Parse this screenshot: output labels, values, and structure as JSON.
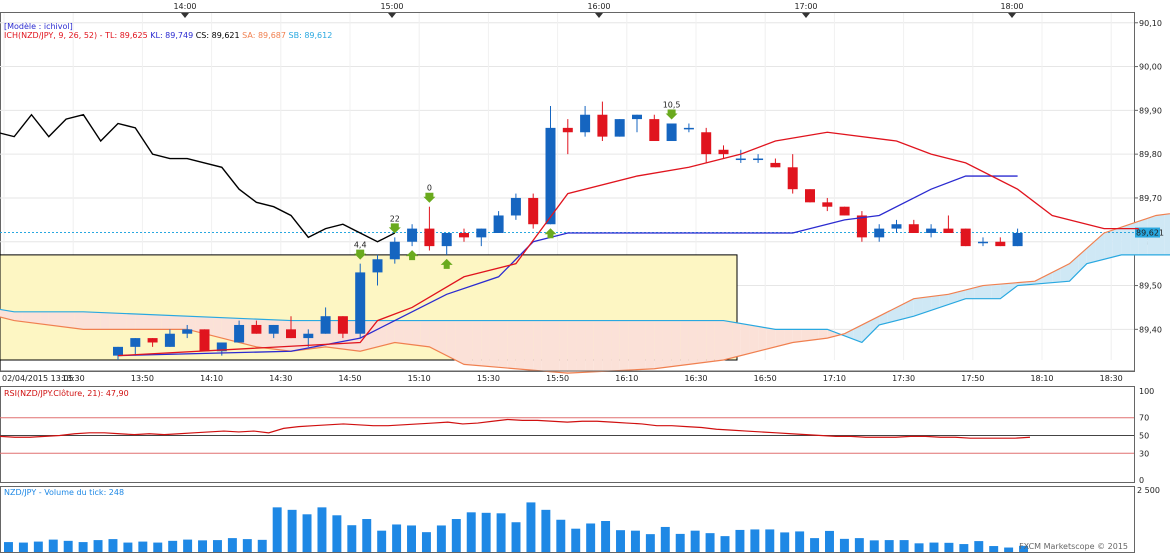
{
  "header": {
    "model_label": "[Modèle : ichivol]",
    "ich_label": "ICH(NZD/JPY, 9, 26, 52) -",
    "tl": "TL: 89,625",
    "kl": "KL: 89,749",
    "cs": "CS: 89,621",
    "sa": "SA: 89,687",
    "sb": "SB: 89,612"
  },
  "rsi_label": "RSI(NZD/JPY.Clôture, 21): 47,90",
  "volume_label": "NZD/JPY - Volume du tick: 248",
  "copyright": "FXCM Marketscope © 2015",
  "colors": {
    "up": "#1565c0",
    "down": "#e0141e",
    "tenkan": "#e0141e",
    "kijun": "#2b2bd0",
    "chikou": "#000000",
    "senkou_a": "#f08050",
    "senkou_b": "#29a8e0",
    "box_fill": "#fdf6c3",
    "cloud_bull": "#cfe8f5",
    "cloud_bear": "#fbe1d8",
    "rsi": "#d01010",
    "volume": "#1e88e5",
    "signal": "#6aaa1e"
  },
  "chart_data": {
    "type": "candlestick",
    "symbol": "NZD/JPY",
    "top_time_labels": [
      "14:00",
      "15:00",
      "16:00",
      "17:00",
      "18:00"
    ],
    "x_tick_labels": [
      "02/04/2015 13:05",
      "13:30",
      "13:50",
      "14:10",
      "14:30",
      "14:50",
      "15:10",
      "15:30",
      "15:50",
      "16:10",
      "16:30",
      "16:50",
      "17:10",
      "17:30",
      "17:50",
      "18:10",
      "18:30"
    ],
    "price_ticks": [
      "90,10",
      "90,00",
      "89,90",
      "89,80",
      "89,70",
      "89,60",
      "89,50",
      "89,40"
    ],
    "price_range": [
      89.33,
      90.12
    ],
    "current_price": "89,621",
    "candles": [
      {
        "t": "13:30",
        "o": 89.34,
        "h": 89.36,
        "l": 89.33,
        "c": 89.36
      },
      {
        "t": "13:35",
        "o": 89.36,
        "h": 89.38,
        "l": 89.34,
        "c": 89.38
      },
      {
        "t": "13:40",
        "o": 89.38,
        "h": 89.38,
        "l": 89.36,
        "c": 89.37
      },
      {
        "t": "13:45",
        "o": 89.36,
        "h": 89.4,
        "l": 89.36,
        "c": 89.39
      },
      {
        "t": "13:50",
        "o": 89.39,
        "h": 89.41,
        "l": 89.38,
        "c": 89.4
      },
      {
        "t": "13:55",
        "o": 89.4,
        "h": 89.4,
        "l": 89.35,
        "c": 89.35
      },
      {
        "t": "14:00",
        "o": 89.35,
        "h": 89.37,
        "l": 89.34,
        "c": 89.37
      },
      {
        "t": "14:05",
        "o": 89.37,
        "h": 89.42,
        "l": 89.37,
        "c": 89.41
      },
      {
        "t": "14:10",
        "o": 89.41,
        "h": 89.42,
        "l": 89.39,
        "c": 89.39
      },
      {
        "t": "14:15",
        "o": 89.39,
        "h": 89.41,
        "l": 89.38,
        "c": 89.41
      },
      {
        "t": "14:20",
        "o": 89.4,
        "h": 89.43,
        "l": 89.38,
        "c": 89.38
      },
      {
        "t": "14:25",
        "o": 89.38,
        "h": 89.4,
        "l": 89.36,
        "c": 89.39
      },
      {
        "t": "14:30",
        "o": 89.39,
        "h": 89.45,
        "l": 89.39,
        "c": 89.43
      },
      {
        "t": "14:35",
        "o": 89.43,
        "h": 89.43,
        "l": 89.38,
        "c": 89.39
      },
      {
        "t": "14:40",
        "o": 89.39,
        "h": 89.55,
        "l": 89.38,
        "c": 89.53
      },
      {
        "t": "14:45",
        "o": 89.53,
        "h": 89.57,
        "l": 89.5,
        "c": 89.56
      },
      {
        "t": "14:50",
        "o": 89.56,
        "h": 89.61,
        "l": 89.55,
        "c": 89.6
      },
      {
        "t": "14:55",
        "o": 89.6,
        "h": 89.64,
        "l": 89.59,
        "c": 89.63
      },
      {
        "t": "15:00",
        "o": 89.63,
        "h": 89.68,
        "l": 89.58,
        "c": 89.59
      },
      {
        "t": "15:05",
        "o": 89.59,
        "h": 89.62,
        "l": 89.57,
        "c": 89.62
      },
      {
        "t": "15:10",
        "o": 89.62,
        "h": 89.63,
        "l": 89.6,
        "c": 89.61
      },
      {
        "t": "15:15",
        "o": 89.61,
        "h": 89.63,
        "l": 89.59,
        "c": 89.63
      },
      {
        "t": "15:20",
        "o": 89.62,
        "h": 89.67,
        "l": 89.62,
        "c": 89.66
      },
      {
        "t": "15:25",
        "o": 89.66,
        "h": 89.71,
        "l": 89.65,
        "c": 89.7
      },
      {
        "t": "15:30",
        "o": 89.7,
        "h": 89.71,
        "l": 89.63,
        "c": 89.64
      },
      {
        "t": "15:35",
        "o": 89.64,
        "h": 89.91,
        "l": 89.64,
        "c": 89.86
      },
      {
        "t": "15:40",
        "o": 89.86,
        "h": 89.88,
        "l": 89.8,
        "c": 89.85
      },
      {
        "t": "15:45",
        "o": 89.85,
        "h": 89.91,
        "l": 89.84,
        "c": 89.89
      },
      {
        "t": "15:50",
        "o": 89.89,
        "h": 89.92,
        "l": 89.83,
        "c": 89.84
      },
      {
        "t": "15:55",
        "o": 89.84,
        "h": 89.88,
        "l": 89.84,
        "c": 89.88
      },
      {
        "t": "16:00",
        "o": 89.88,
        "h": 89.89,
        "l": 89.85,
        "c": 89.89
      },
      {
        "t": "16:05",
        "o": 89.88,
        "h": 89.89,
        "l": 89.83,
        "c": 89.83
      },
      {
        "t": "16:10",
        "o": 89.83,
        "h": 89.87,
        "l": 89.83,
        "c": 89.87
      },
      {
        "t": "16:15",
        "o": 89.86,
        "h": 89.87,
        "l": 89.85,
        "c": 89.86
      },
      {
        "t": "16:20",
        "o": 89.85,
        "h": 89.86,
        "l": 89.78,
        "c": 89.8
      },
      {
        "t": "16:25",
        "o": 89.81,
        "h": 89.82,
        "l": 89.79,
        "c": 89.8
      },
      {
        "t": "16:30",
        "o": 89.79,
        "h": 89.81,
        "l": 89.78,
        "c": 89.79
      },
      {
        "t": "16:35",
        "o": 89.79,
        "h": 89.8,
        "l": 89.78,
        "c": 89.79
      },
      {
        "t": "16:40",
        "o": 89.78,
        "h": 89.79,
        "l": 89.77,
        "c": 89.77
      },
      {
        "t": "16:45",
        "o": 89.77,
        "h": 89.8,
        "l": 89.71,
        "c": 89.72
      },
      {
        "t": "16:50",
        "o": 89.72,
        "h": 89.72,
        "l": 89.69,
        "c": 89.69
      },
      {
        "t": "16:55",
        "o": 89.69,
        "h": 89.7,
        "l": 89.67,
        "c": 89.68
      },
      {
        "t": "17:00",
        "o": 89.68,
        "h": 89.68,
        "l": 89.66,
        "c": 89.66
      },
      {
        "t": "17:05",
        "o": 89.66,
        "h": 89.67,
        "l": 89.6,
        "c": 89.61
      },
      {
        "t": "17:10",
        "o": 89.61,
        "h": 89.64,
        "l": 89.6,
        "c": 89.63
      },
      {
        "t": "17:15",
        "o": 89.63,
        "h": 89.65,
        "l": 89.62,
        "c": 89.64
      },
      {
        "t": "17:20",
        "o": 89.64,
        "h": 89.65,
        "l": 89.62,
        "c": 89.62
      },
      {
        "t": "17:25",
        "o": 89.62,
        "h": 89.64,
        "l": 89.61,
        "c": 89.63
      },
      {
        "t": "17:30",
        "o": 89.63,
        "h": 89.66,
        "l": 89.62,
        "c": 89.62
      },
      {
        "t": "17:35",
        "o": 89.63,
        "h": 89.63,
        "l": 89.59,
        "c": 89.59
      },
      {
        "t": "17:40",
        "o": 89.6,
        "h": 89.61,
        "l": 89.59,
        "c": 89.6
      },
      {
        "t": "17:45",
        "o": 89.6,
        "h": 89.61,
        "l": 89.59,
        "c": 89.59
      },
      {
        "t": "17:50",
        "o": 89.59,
        "h": 89.63,
        "l": 89.59,
        "c": 89.62
      }
    ],
    "tenkan": [
      [
        0,
        89.34
      ],
      [
        14,
        89.37
      ],
      [
        15,
        89.42
      ],
      [
        17,
        89.45
      ],
      [
        20,
        89.52
      ],
      [
        23,
        89.55
      ],
      [
        26,
        89.71
      ],
      [
        30,
        89.75
      ],
      [
        33,
        89.77
      ],
      [
        36,
        89.8
      ],
      [
        38,
        89.83
      ],
      [
        41,
        89.85
      ],
      [
        45,
        89.83
      ],
      [
        47,
        89.8
      ],
      [
        49,
        89.78
      ],
      [
        52,
        89.72
      ],
      [
        54,
        89.66
      ],
      [
        57,
        89.63
      ],
      [
        59,
        89.63
      ]
    ],
    "kijun": [
      [
        0,
        89.34
      ],
      [
        10,
        89.35
      ],
      [
        14,
        89.38
      ],
      [
        16,
        89.42
      ],
      [
        19,
        89.48
      ],
      [
        22,
        89.52
      ],
      [
        24,
        89.6
      ],
      [
        26,
        89.62
      ],
      [
        39,
        89.62
      ],
      [
        42,
        89.65
      ],
      [
        44,
        89.66
      ],
      [
        47,
        89.72
      ],
      [
        49,
        89.75
      ],
      [
        52,
        89.75
      ]
    ],
    "chikou": [
      [
        -13,
        89.62
      ],
      [
        -12,
        89.6
      ],
      [
        -11,
        89.63
      ],
      [
        -10,
        89.68
      ],
      [
        -9,
        89.71
      ],
      [
        -8,
        89.65
      ],
      [
        -7,
        89.85
      ],
      [
        -6,
        89.84
      ],
      [
        -5,
        89.89
      ],
      [
        -4,
        89.84
      ],
      [
        -3,
        89.88
      ],
      [
        -2,
        89.89
      ],
      [
        -1,
        89.83
      ],
      [
        0,
        89.87
      ],
      [
        1,
        89.86
      ],
      [
        2,
        89.8
      ],
      [
        3,
        89.79
      ],
      [
        4,
        89.79
      ],
      [
        5,
        89.78
      ],
      [
        6,
        89.77
      ],
      [
        7,
        89.72
      ],
      [
        8,
        89.69
      ],
      [
        9,
        89.68
      ],
      [
        10,
        89.66
      ],
      [
        11,
        89.61
      ],
      [
        12,
        89.63
      ],
      [
        13,
        89.64
      ],
      [
        14,
        89.62
      ],
      [
        15,
        89.6
      ],
      [
        16,
        89.62
      ]
    ],
    "senkou_a": [
      [
        -13,
        89.48
      ],
      [
        -9,
        89.45
      ],
      [
        -6,
        89.42
      ],
      [
        -2,
        89.4
      ],
      [
        0,
        89.4
      ],
      [
        4,
        89.4
      ],
      [
        6,
        89.38
      ],
      [
        8,
        89.36
      ],
      [
        10,
        89.35
      ],
      [
        12,
        89.36
      ],
      [
        14,
        89.35
      ],
      [
        16,
        89.37
      ],
      [
        18,
        89.36
      ],
      [
        20,
        89.32
      ],
      [
        26,
        89.3
      ],
      [
        31,
        89.31
      ],
      [
        35,
        89.33
      ],
      [
        39,
        89.37
      ],
      [
        41,
        89.38
      ],
      [
        42,
        89.39
      ],
      [
        44,
        89.43
      ],
      [
        46,
        89.47
      ],
      [
        48,
        89.48
      ],
      [
        50,
        89.5
      ],
      [
        53,
        89.51
      ],
      [
        55,
        89.55
      ],
      [
        57,
        89.62
      ],
      [
        60,
        89.66
      ],
      [
        62,
        89.67
      ],
      [
        66,
        89.69
      ],
      [
        69,
        89.7
      ]
    ],
    "senkou_b": [
      [
        -13,
        89.46
      ],
      [
        -9,
        89.46
      ],
      [
        -6,
        89.44
      ],
      [
        -2,
        89.44
      ],
      [
        10,
        89.42
      ],
      [
        35,
        89.42
      ],
      [
        38,
        89.4
      ],
      [
        41,
        89.4
      ],
      [
        43,
        89.37
      ],
      [
        44,
        89.41
      ],
      [
        46,
        89.43
      ],
      [
        49,
        89.47
      ],
      [
        51,
        89.47
      ],
      [
        52,
        89.5
      ],
      [
        55,
        89.51
      ],
      [
        56,
        89.55
      ],
      [
        58,
        89.57
      ],
      [
        69,
        89.57
      ]
    ],
    "signals": [
      {
        "i": 14,
        "dir": "down",
        "label": "4,4"
      },
      {
        "i": 16,
        "dir": "down",
        "label": "22"
      },
      {
        "i": 17,
        "dir": "up",
        "label": ""
      },
      {
        "i": 18,
        "dir": "down",
        "label": "0"
      },
      {
        "i": 19,
        "dir": "up",
        "label": ""
      },
      {
        "i": 25,
        "dir": "up",
        "label": ""
      },
      {
        "i": 32,
        "dir": "down",
        "label": "10,5"
      }
    ],
    "rsi": {
      "ticks": [
        "100",
        "70",
        "50",
        "30",
        "0"
      ],
      "values": [
        49,
        48,
        48,
        49,
        50,
        52,
        53,
        53,
        52,
        51,
        52,
        51,
        52,
        53,
        54,
        55,
        54,
        55,
        53,
        58,
        60,
        61,
        62,
        63,
        62,
        61,
        61,
        62,
        63,
        64,
        65,
        63,
        64,
        66,
        68,
        67,
        67,
        66,
        65,
        66,
        66,
        65,
        64,
        63,
        61,
        61,
        60,
        59,
        57,
        56,
        55,
        54,
        53,
        52,
        51,
        50,
        49,
        49,
        48,
        48,
        48,
        49,
        49,
        48,
        48,
        47,
        47,
        47,
        47,
        48
      ]
    },
    "volume": {
      "tick_label": "2 500",
      "values": [
        400,
        380,
        420,
        500,
        450,
        400,
        480,
        520,
        380,
        420,
        380,
        450,
        500,
        470,
        480,
        560,
        520,
        490,
        1800,
        1700,
        1520,
        1800,
        1480,
        1080,
        1330,
        860,
        1110,
        1070,
        800,
        1070,
        1330,
        1600,
        1580,
        1560,
        1200,
        2000,
        1700,
        1300,
        940,
        1150,
        1250,
        880,
        860,
        720,
        1010,
        730,
        860,
        760,
        640,
        890,
        910,
        910,
        790,
        830,
        560,
        850,
        530,
        560,
        470,
        480,
        480,
        350,
        380,
        370,
        320,
        440,
        240,
        180,
        248
      ]
    }
  }
}
